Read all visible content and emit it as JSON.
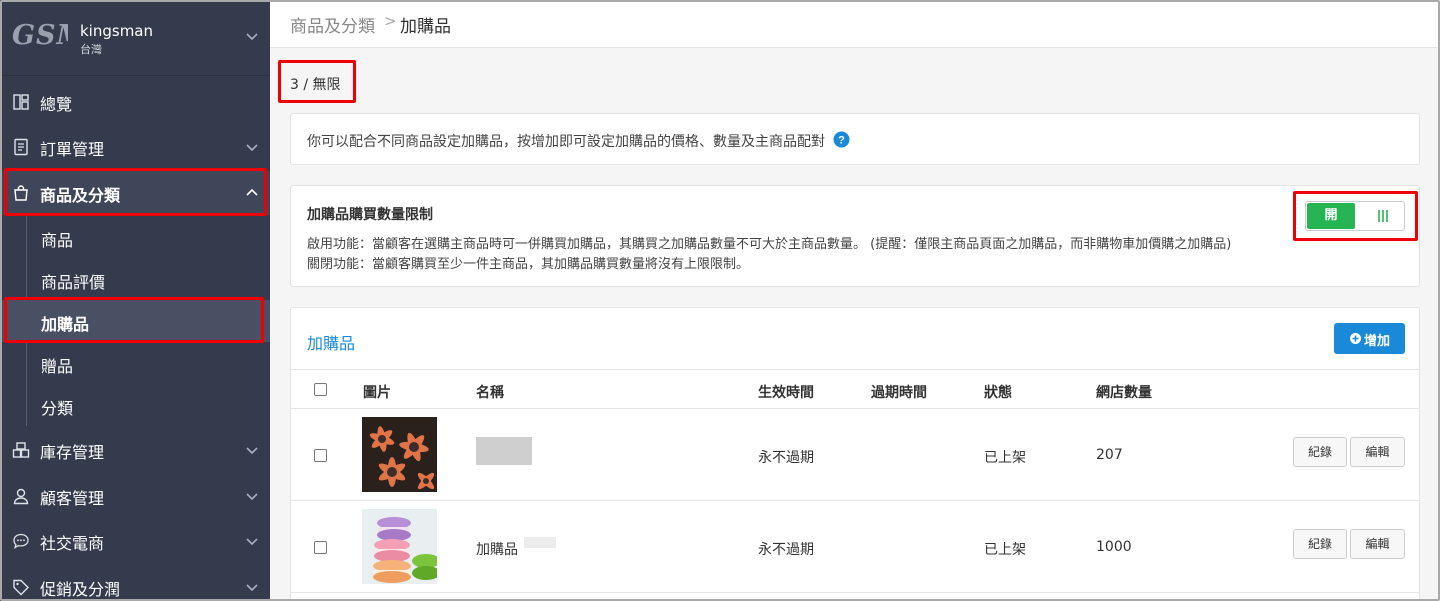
{
  "store": {
    "logo_text": "GSM",
    "name": "kingsman",
    "region": "台灣"
  },
  "nav": {
    "overview": "總覽",
    "orders": "訂單管理",
    "products": "商品及分類",
    "sub": {
      "products": "商品",
      "reviews": "商品評價",
      "addons": "加購品",
      "gifts": "贈品",
      "categories": "分類"
    },
    "inventory": "庫存管理",
    "customers": "顧客管理",
    "social": "社交電商",
    "promotions": "促銷及分潤"
  },
  "breadcrumb": {
    "parent": "商品及分類",
    "separator": ">",
    "current": "加購品"
  },
  "quota": "3 / 無限",
  "info": {
    "text": "你可以配合不同商品設定加購品，按增加即可設定加購品的價格、數量及主商品配對"
  },
  "limit": {
    "title": "加購品購買數量限制",
    "on_desc": "啟用功能：當顧客在選購主商品時可一併購買加購品，其購買之加購品數量不可大於主商品數量。 (提醒：僅限主商品頁面之加購品，而非購物車加價購之加購品)",
    "off_desc": "關閉功能：當顧客購買至少一件主商品，其加購品購買數量將沒有上限限制。",
    "toggle_on_label": "開",
    "enabled": true
  },
  "list": {
    "title": "加購品",
    "add_label": "增加",
    "columns": {
      "image": "圖片",
      "name": "名稱",
      "start": "生效時間",
      "end": "過期時間",
      "status": "狀態",
      "qty": "網店數量"
    },
    "rows": [
      {
        "name": "",
        "start": "永不過期",
        "end": "",
        "status": "已上架",
        "qty": "207",
        "log_label": "紀錄",
        "edit_label": "編輯"
      },
      {
        "name": "加購品",
        "start": "永不過期",
        "end": "",
        "status": "已上架",
        "qty": "1000",
        "log_label": "紀錄",
        "edit_label": "編輯"
      }
    ]
  },
  "colors": {
    "sidebar": "#353b4d",
    "accent": "#1a8ad8",
    "toggle_on": "#27b553",
    "highlight": "#e00000"
  }
}
